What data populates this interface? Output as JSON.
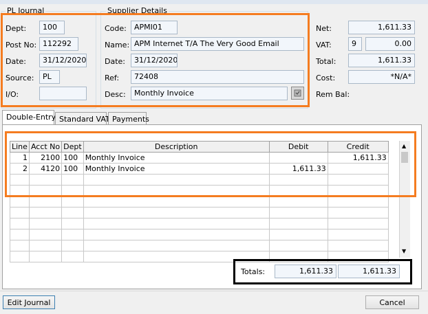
{
  "pl_journal": {
    "group_title": "PL Journal",
    "dept_label": "Dept:",
    "dept_value": "100",
    "post_no_label": "Post No:",
    "post_no_value": "112292",
    "date_label": "Date:",
    "date_value": "31/12/2020",
    "source_label": "Source:",
    "source_value": "PL",
    "io_label": "I/O:",
    "io_value": ""
  },
  "supplier": {
    "group_title": "Supplier Details",
    "code_label": "Code:",
    "code_value": "APMI01",
    "name_label": "Name:",
    "name_value": "APM Internet T/A The Very Good Email",
    "date_label": "Date:",
    "date_value": "31/12/2020",
    "ref_label": "Ref:",
    "ref_value": "72408",
    "desc_label": "Desc:",
    "desc_value": "Monthly Invoice"
  },
  "summary": {
    "net_label": "Net:",
    "net_value": "1,611.33",
    "vat_label": "VAT:",
    "vat_code": "9",
    "vat_value": "0.00",
    "total_label": "Total:",
    "total_value": "1,611.33",
    "cost_label": "Cost:",
    "cost_value": "*N/A*",
    "rem_bal_label": "Rem Bal:"
  },
  "tabs": [
    {
      "label": "Double-Entry",
      "active": true
    },
    {
      "label": "Standard VAT",
      "active": false
    },
    {
      "label": "Payments",
      "active": false
    }
  ],
  "grid": {
    "columns": [
      "Line",
      "Acct No",
      "Dept",
      "Description",
      "Debit",
      "Credit"
    ],
    "rows": [
      {
        "line": "1",
        "acct": "2100",
        "dept": "100",
        "desc": "Monthly Invoice",
        "debit": "",
        "credit": "1,611.33"
      },
      {
        "line": "2",
        "acct": "4120",
        "dept": "100",
        "desc": "Monthly Invoice",
        "debit": "1,611.33",
        "credit": ""
      }
    ]
  },
  "totals": {
    "label": "Totals:",
    "debit": "1,611.33",
    "credit": "1,611.33"
  },
  "buttons": {
    "edit_journal": "Edit Journal",
    "cancel": "Cancel"
  },
  "colors": {
    "highlight_orange": "#f57c20",
    "highlight_black": "#000000"
  }
}
